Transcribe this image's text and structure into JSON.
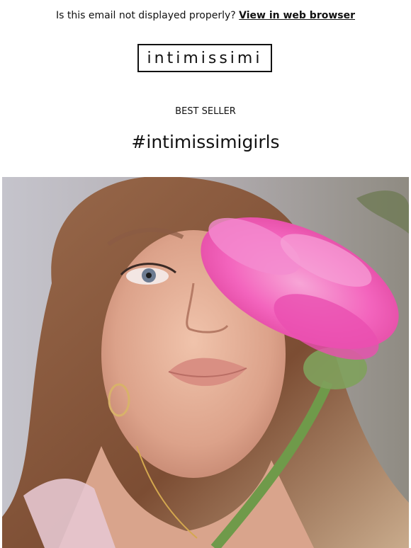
{
  "preheader": {
    "text": "Is this email not displayed properly?",
    "link_label": "View in web browser"
  },
  "brand": {
    "logo_text": "intimissimi"
  },
  "section": {
    "kicker": "BEST SELLER",
    "headline": "#intimissimigirls"
  },
  "hero": {
    "description_icon": "photo-woman-with-pink-flower",
    "colors": {
      "flower": "#f25fb8",
      "stem": "#6f9a4a",
      "hair": "#8c5a3a",
      "skin": "#e7b39a"
    }
  }
}
